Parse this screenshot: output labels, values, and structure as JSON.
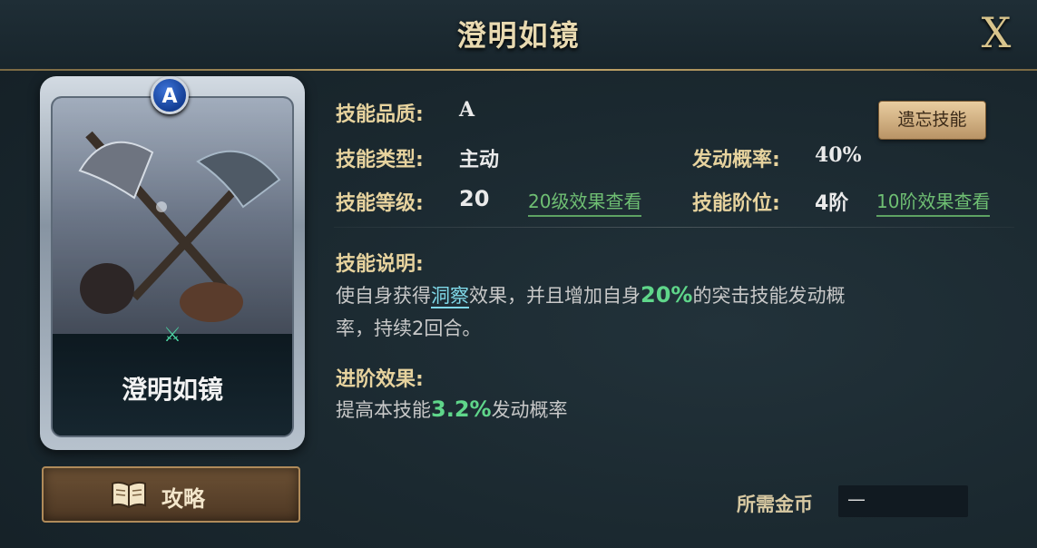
{
  "window": {
    "title": "澄明如镜",
    "close_label": "X"
  },
  "card": {
    "name": "澄明如镜",
    "grade_badge": "A",
    "class_icon": "crossed-axes-icon"
  },
  "guide_button": {
    "label": "攻略",
    "icon": "book-icon"
  },
  "skill": {
    "quality_label": "技能品质:",
    "quality_value": "A",
    "type_label": "技能类型:",
    "type_value": "主动",
    "level_label": "技能等级:",
    "level_value": "20",
    "level_link": "20级效果查看",
    "chance_label": "发动概率:",
    "chance_value": "40%",
    "tier_label": "技能阶位:",
    "tier_value": "4阶",
    "tier_link": "10阶效果查看"
  },
  "forget_button": {
    "label": "遗忘技能"
  },
  "description": {
    "label": "技能说明:",
    "line1_pre": "使自身获得",
    "line1_term": "洞察",
    "line1_mid": "效果，并且增加自身",
    "line1_value": "20%",
    "line1_post": "的突击技能发动概",
    "line2": "率，持续2回合。"
  },
  "advance": {
    "label": "进阶效果:",
    "pre": "提高本技能",
    "value": "3.2%",
    "post": "发动概率"
  },
  "gold": {
    "label": "所需金币",
    "value": "—"
  },
  "colors": {
    "label_gold": "#e7d39e",
    "value_green": "#5fd68a",
    "link_green": "#6fbf73",
    "term_cyan": "#7fd8e8"
  }
}
